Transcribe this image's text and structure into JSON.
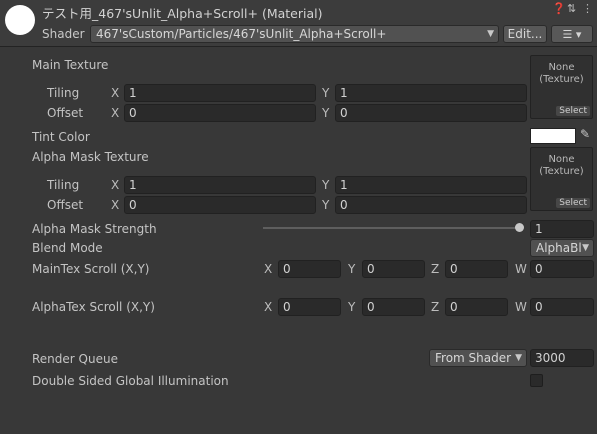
{
  "header": {
    "title": "テスト用_467'sUnlit_Alpha+Scroll+ (Material)",
    "shader_label": "Shader",
    "shader_value": "467'sCustom/Particles/467'sUnlit_Alpha+Scroll+",
    "edit_label": "Edit...",
    "icons": [
      "help-icon",
      "preset-icon",
      "more-icon"
    ]
  },
  "main_texture": {
    "label": "Main Texture",
    "tiling_label": "Tiling",
    "offset_label": "Offset",
    "tiling": {
      "x": "1",
      "y": "1"
    },
    "offset": {
      "x": "0",
      "y": "0"
    },
    "slot_text": "None\n(Texture)",
    "select_label": "Select"
  },
  "tint_color": {
    "label": "Tint Color",
    "color": "#ffffff"
  },
  "alpha_mask_texture": {
    "label": "Alpha Mask Texture",
    "tiling_label": "Tiling",
    "offset_label": "Offset",
    "tiling": {
      "x": "1",
      "y": "1"
    },
    "offset": {
      "x": "0",
      "y": "0"
    },
    "slot_text": "None\n(Texture)",
    "select_label": "Select"
  },
  "alpha_mask_strength": {
    "label": "Alpha Mask Strength",
    "value": "1",
    "level": 1.0
  },
  "blend_mode": {
    "label": "Blend Mode",
    "value": "AlphaBl"
  },
  "maintex_scroll": {
    "label": "MainTex Scroll (X,Y)",
    "x": "0",
    "y": "0",
    "z": "0",
    "w": "0"
  },
  "alphatex_scroll": {
    "label": "AlphaTex Scroll (X,Y)",
    "x": "0",
    "y": "0",
    "z": "0",
    "w": "0"
  },
  "render_queue": {
    "label": "Render Queue",
    "mode": "From Shader",
    "value": "3000"
  },
  "double_sided_gi": {
    "label": "Double Sided Global Illumination",
    "checked": false
  },
  "axes": {
    "x": "X",
    "y": "Y",
    "z": "Z",
    "w": "W"
  }
}
